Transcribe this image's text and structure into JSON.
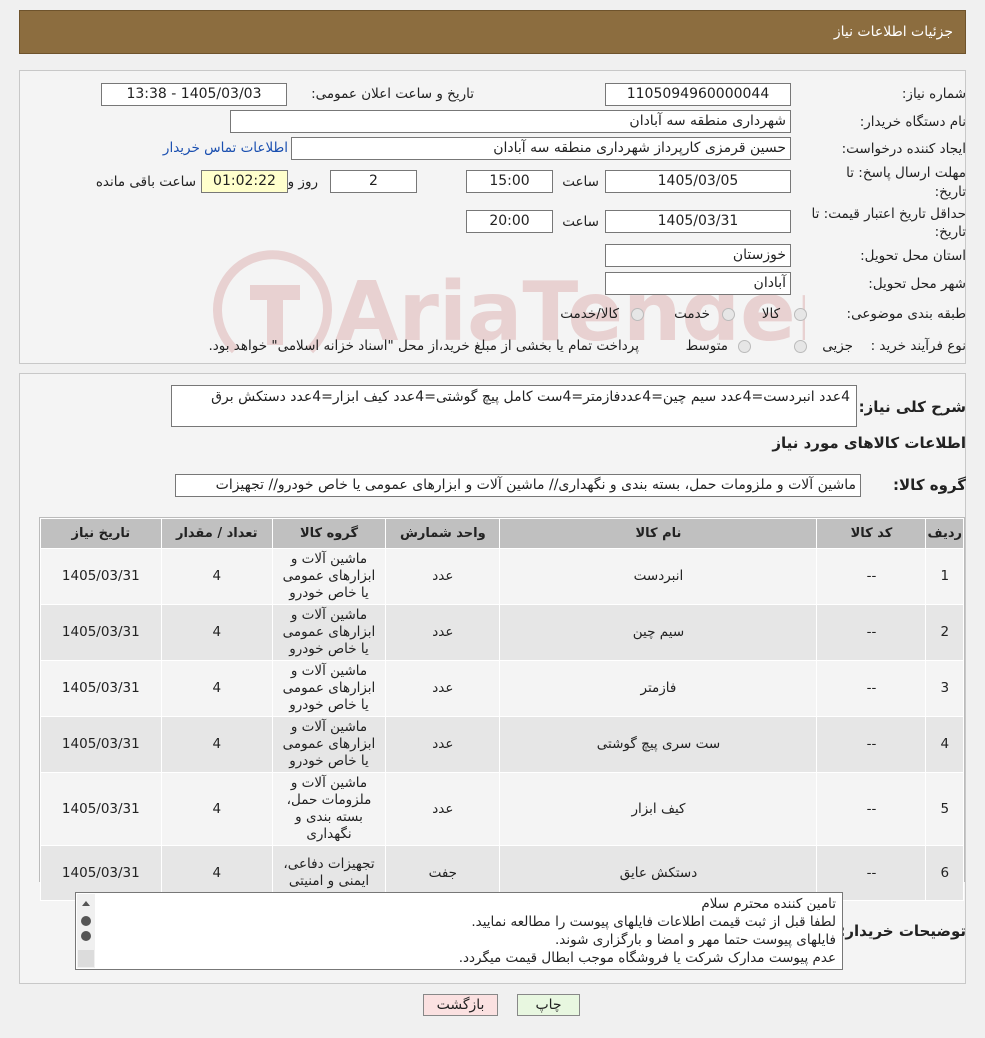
{
  "header": {
    "title": "جزئیات اطلاعات نیاز"
  },
  "watermark": {
    "text": "AriaTender.neT"
  },
  "form": {
    "need_number_label": "شماره نیاز:",
    "need_number": "1105094960000044",
    "announce_label": "تاریخ و ساعت اعلان عمومی:",
    "announce_value": "1405/03/03 - 13:38",
    "buyer_org_label": "نام دستگاه خریدار:",
    "buyer_org": "شهرداری منطقه سه آبادان",
    "requester_label": "ایجاد کننده درخواست:",
    "requester": "حسین قرمزی کارپرداز شهرداری منطقه سه آبادان",
    "contact_link": "اطلاعات تماس خریدار",
    "deadline_label_1": "مهلت ارسال پاسخ: تا",
    "deadline_label_2": "تاریخ:",
    "deadline_date": "1405/03/05",
    "time_label": "ساعت",
    "deadline_time": "15:00",
    "days_value": "2",
    "days_label": "روز و",
    "remaining_time": "01:02:22",
    "remaining_label": "ساعت باقی مانده",
    "validity_label_1": "حداقل تاریخ اعتبار قیمت: تا",
    "validity_label_2": "تاریخ:",
    "validity_date": "1405/03/31",
    "validity_time": "20:00",
    "province_label": "استان محل تحویل:",
    "province": "خوزستان",
    "city_label": "شهر محل تحویل:",
    "city": "آبادان",
    "category_label": "طبقه بندی موضوعی:",
    "category_options": [
      "کالا",
      "خدمت",
      "کالا/خدمت"
    ],
    "process_label": "نوع فرآیند خرید :",
    "process_options": [
      "جزیی",
      "متوسط"
    ],
    "process_note": "پرداخت تمام یا بخشی از مبلغ خرید،از محل \"اسناد خزانه اسلامی\" خواهد بود."
  },
  "summary": {
    "label": "شرح کلی نیاز:",
    "text": "4عدد انبردست=4عدد سیم چین=4عددفازمتر=4ست کامل پیچ گوشتی=4عدد کیف ابزار=4عدد دستکش برق"
  },
  "goods": {
    "section_title": "اطلاعات کالاهای مورد نیاز",
    "group_label": "گروه کالا:",
    "group_value": "ماشین آلات و ملزومات حمل، بسته بندی و نگهداری//  ماشین آلات و ابزارهای عمومی یا خاص خودرو// تجهیزات"
  },
  "table": {
    "headers": [
      "ردیف",
      "کد کالا",
      "نام کالا",
      "واحد شمارش",
      "گروه کالا",
      "تعداد / مقدار",
      "تاریخ نیاز"
    ],
    "rows": [
      {
        "idx": "1",
        "code": "--",
        "name": "انبردست",
        "unit": "عدد",
        "group": "ماشین آلات و ابزارهای عمومی یا خاص خودرو",
        "qty": "4",
        "date": "1405/03/31"
      },
      {
        "idx": "2",
        "code": "--",
        "name": "سیم چین",
        "unit": "عدد",
        "group": "ماشین آلات و ابزارهای عمومی یا خاص خودرو",
        "qty": "4",
        "date": "1405/03/31"
      },
      {
        "idx": "3",
        "code": "--",
        "name": "فازمتر",
        "unit": "عدد",
        "group": "ماشین آلات و ابزارهای عمومی یا خاص خودرو",
        "qty": "4",
        "date": "1405/03/31"
      },
      {
        "idx": "4",
        "code": "--",
        "name": "ست سری پیچ گوشتی",
        "unit": "عدد",
        "group": "ماشین آلات و ابزارهای عمومی یا خاص خودرو",
        "qty": "4",
        "date": "1405/03/31"
      },
      {
        "idx": "5",
        "code": "--",
        "name": "کیف ابزار",
        "unit": "عدد",
        "group": "ماشین آلات و ملزومات حمل، بسته بندی و نگهداری",
        "qty": "4",
        "date": "1405/03/31"
      },
      {
        "idx": "6",
        "code": "--",
        "name": "دستکش عایق",
        "unit": "جفت",
        "group": "تجهیزات دفاعی، ایمنی و امنیتی",
        "qty": "4",
        "date": "1405/03/31"
      }
    ]
  },
  "notes": {
    "label": "توضیحات خریدار:",
    "lines": [
      "تامین کننده محترم سلام",
      "لطفا قبل از ثبت قیمت اطلاعات فایلهای پیوست را مطالعه نمایید.",
      "فایلهای پیوست حتما مهر و امضا و بارگزاری شوند.",
      "عدم پیوست مدارک شرکت یا فروشگاه موجب ابطال قیمت میگردد."
    ]
  },
  "buttons": {
    "print": "چاپ",
    "back": "بازگشت"
  },
  "colors": {
    "header_bg": "#8c6d3f",
    "link": "#1a4fb0",
    "print_btn_bg": "#e8f7e0",
    "back_btn_bg": "#fbe1e1"
  }
}
